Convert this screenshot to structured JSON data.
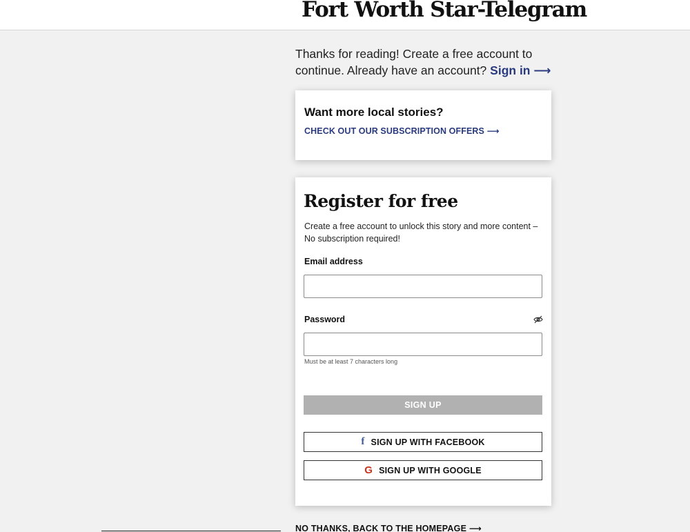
{
  "header": {
    "logo_text": "Fort Worth Star-Telegram"
  },
  "intro": {
    "text": "Thanks for reading! Create a free account to continue. Already have an account?",
    "signin_label": "Sign in",
    "arrow": "⟶"
  },
  "offers": {
    "title": "Want more local stories?",
    "link_label": "CHECK OUT OUR SUBSCRIPTION OFFERS",
    "arrow": "⟶"
  },
  "register": {
    "title": "Register for free",
    "subtitle": "Create a free account to unlock this story and more content – No subscription required!",
    "email_label": "Email address",
    "email_value": "",
    "password_label": "Password",
    "password_value": "",
    "password_hint": "Must be at least 7 characters long",
    "signup_label": "SIGN UP",
    "facebook_label": "SIGN UP WITH FACEBOOK",
    "google_label": "SIGN UP WITH GOOGLE",
    "icons": {
      "password_toggle": "eye-slash-icon",
      "facebook": "facebook-icon",
      "google": "google-icon"
    }
  },
  "footer": {
    "no_thanks_label": "NO THANKS, BACK TO THE HOMEPAGE",
    "arrow": "⟶"
  },
  "colors": {
    "background": "#f1f1f1",
    "link_blue": "#2a3a7e",
    "disabled_button": "#b1b1b1",
    "facebook_blue": "#3b5998",
    "google_red": "#c7361f"
  }
}
